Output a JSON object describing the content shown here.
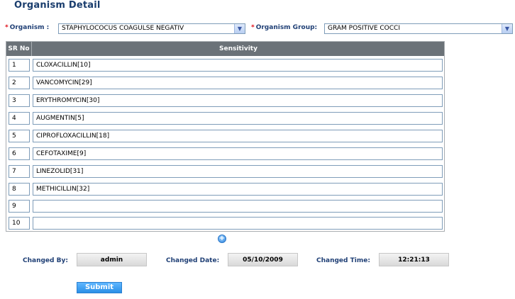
{
  "page": {
    "title": "Organism Detail"
  },
  "form": {
    "required_mark": "*",
    "organism": {
      "label": "Organism :",
      "selected": "STAPHYLOCOCUS COAGULSE NEGATIV"
    },
    "organism_group": {
      "label": "Organism Group:",
      "selected": "GRAM POSITIVE COCCI"
    }
  },
  "grid": {
    "headers": {
      "sr_no": "SR No",
      "sensitivity": "Sensitivity"
    },
    "rows": [
      {
        "sr": "1",
        "sensitivity": "CLOXACILLIN[10]"
      },
      {
        "sr": "2",
        "sensitivity": "VANCOMYCIN[29]"
      },
      {
        "sr": "3",
        "sensitivity": "ERYTHROMYCIN[30]"
      },
      {
        "sr": "4",
        "sensitivity": "AUGMENTIN[5]"
      },
      {
        "sr": "5",
        "sensitivity": "CIPROFLOXACILLIN[18]"
      },
      {
        "sr": "6",
        "sensitivity": "CEFOTAXIME[9]"
      },
      {
        "sr": "7",
        "sensitivity": "LINEZOLID[31]"
      },
      {
        "sr": "8",
        "sensitivity": "METHICILLIN[32]"
      },
      {
        "sr": "9",
        "sensitivity": ""
      },
      {
        "sr": "10",
        "sensitivity": ""
      }
    ]
  },
  "add_button": {
    "icon": "plus-circle-icon",
    "glyph": "+"
  },
  "meta": {
    "changed_by_label": "Changed By:",
    "changed_by": "admin",
    "changed_date_label": "Changed Date:",
    "changed_date": "05/10/2009",
    "changed_time_label": "Changed Time:",
    "changed_time": "12:21:13"
  },
  "actions": {
    "submit_label": "Submit"
  },
  "colors": {
    "heading": "#1a3d6d",
    "label": "#1f3f75",
    "required": "#e0101a",
    "grid_header_bg": "#6b7278",
    "submit_bg": "#2a8fe6"
  }
}
